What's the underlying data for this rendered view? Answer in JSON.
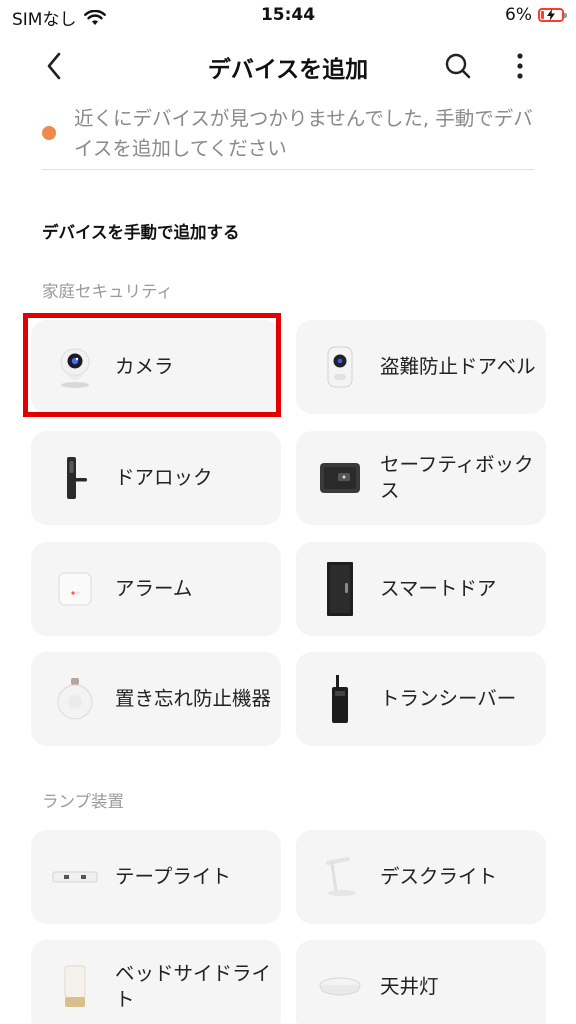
{
  "status_bar": {
    "carrier": "SIMなし",
    "time": "15:44",
    "battery": "6%"
  },
  "header": {
    "title": "デバイスを追加",
    "back_icon": "chevron-left-icon",
    "search_icon": "search-icon",
    "more_icon": "more-vertical-icon"
  },
  "notice": {
    "text": "近くにデバイスが見つかりませんでした, 手動でデバイスを追加してください",
    "dot_color": "#f08a4b"
  },
  "manual_heading": "デバイスを手動で追加する",
  "sections": {
    "security": {
      "label": "家庭セキュリティ",
      "items": [
        {
          "label": "カメラ",
          "icon": "camera-icon"
        },
        {
          "label": "盗難防止ドアベル",
          "icon": "doorbell-icon"
        },
        {
          "label": "ドアロック",
          "icon": "door-lock-icon"
        },
        {
          "label": "セーフティボックス",
          "icon": "safe-box-icon"
        },
        {
          "label": "アラーム",
          "icon": "alarm-icon"
        },
        {
          "label": "スマートドア",
          "icon": "smart-door-icon"
        },
        {
          "label": "置き忘れ防止機器",
          "icon": "anti-lost-tracker-icon"
        },
        {
          "label": "トランシーバー",
          "icon": "walkie-talkie-icon"
        }
      ]
    },
    "lamps": {
      "label": "ランプ装置",
      "items": [
        {
          "label": "テープライト",
          "icon": "tape-light-icon"
        },
        {
          "label": "デスクライト",
          "icon": "desk-lamp-icon"
        },
        {
          "label": "ベッドサイドライト",
          "icon": "bedside-lamp-icon"
        },
        {
          "label": "天井灯",
          "icon": "ceiling-light-icon"
        }
      ]
    }
  },
  "colors": {
    "highlight": "#e30000",
    "card_bg": "#f5f5f5"
  }
}
